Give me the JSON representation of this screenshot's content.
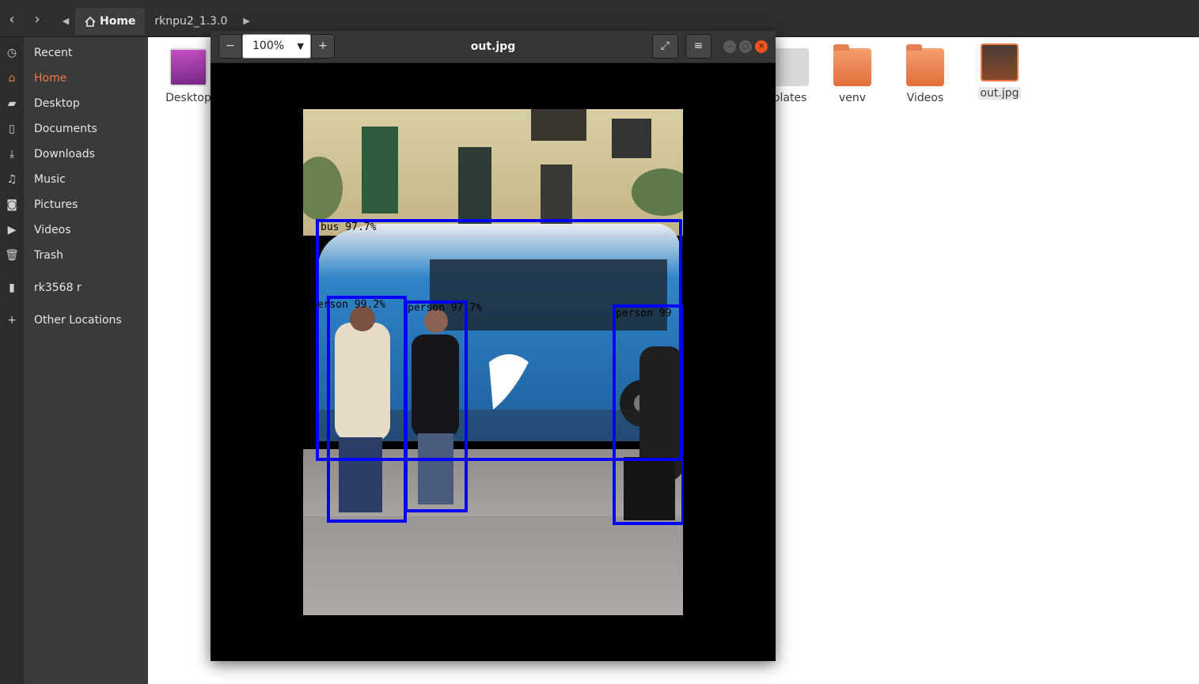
{
  "file_manager": {
    "nav": {
      "back_icon": "chevron-left-icon",
      "forward_icon": "chevron-right-icon"
    },
    "breadcrumbs": [
      "Home",
      "rknpu2_1.3.0"
    ],
    "sidebar": [
      {
        "label": "Recent",
        "icon": "clock-icon"
      },
      {
        "label": "Home",
        "icon": "home-icon",
        "active": true
      },
      {
        "label": "Desktop",
        "icon": "folder-icon"
      },
      {
        "label": "Documents",
        "icon": "document-icon"
      },
      {
        "label": "Downloads",
        "icon": "download-icon"
      },
      {
        "label": "Music",
        "icon": "music-icon"
      },
      {
        "label": "Pictures",
        "icon": "camera-icon"
      },
      {
        "label": "Videos",
        "icon": "video-icon"
      },
      {
        "label": "Trash",
        "icon": "trash-icon"
      },
      {
        "label": "rk3568 r",
        "icon": "usb-drive-icon"
      },
      {
        "label": "Other Locations",
        "icon": "plus-icon"
      }
    ],
    "files": [
      "Desktop",
      "plates",
      "venv",
      "Videos",
      "out.jpg"
    ],
    "accent_color": "#f07746"
  },
  "viewer": {
    "title": "out.jpg",
    "zoom": "100%",
    "zoom_out_symbol": "−",
    "zoom_in_symbol": "+",
    "detections": [
      {
        "label": "bus 97.7%"
      },
      {
        "label": "person 99.2%"
      },
      {
        "label": "person 97.7%"
      },
      {
        "label": "person 99"
      }
    ],
    "box_color": "#0000ff"
  }
}
